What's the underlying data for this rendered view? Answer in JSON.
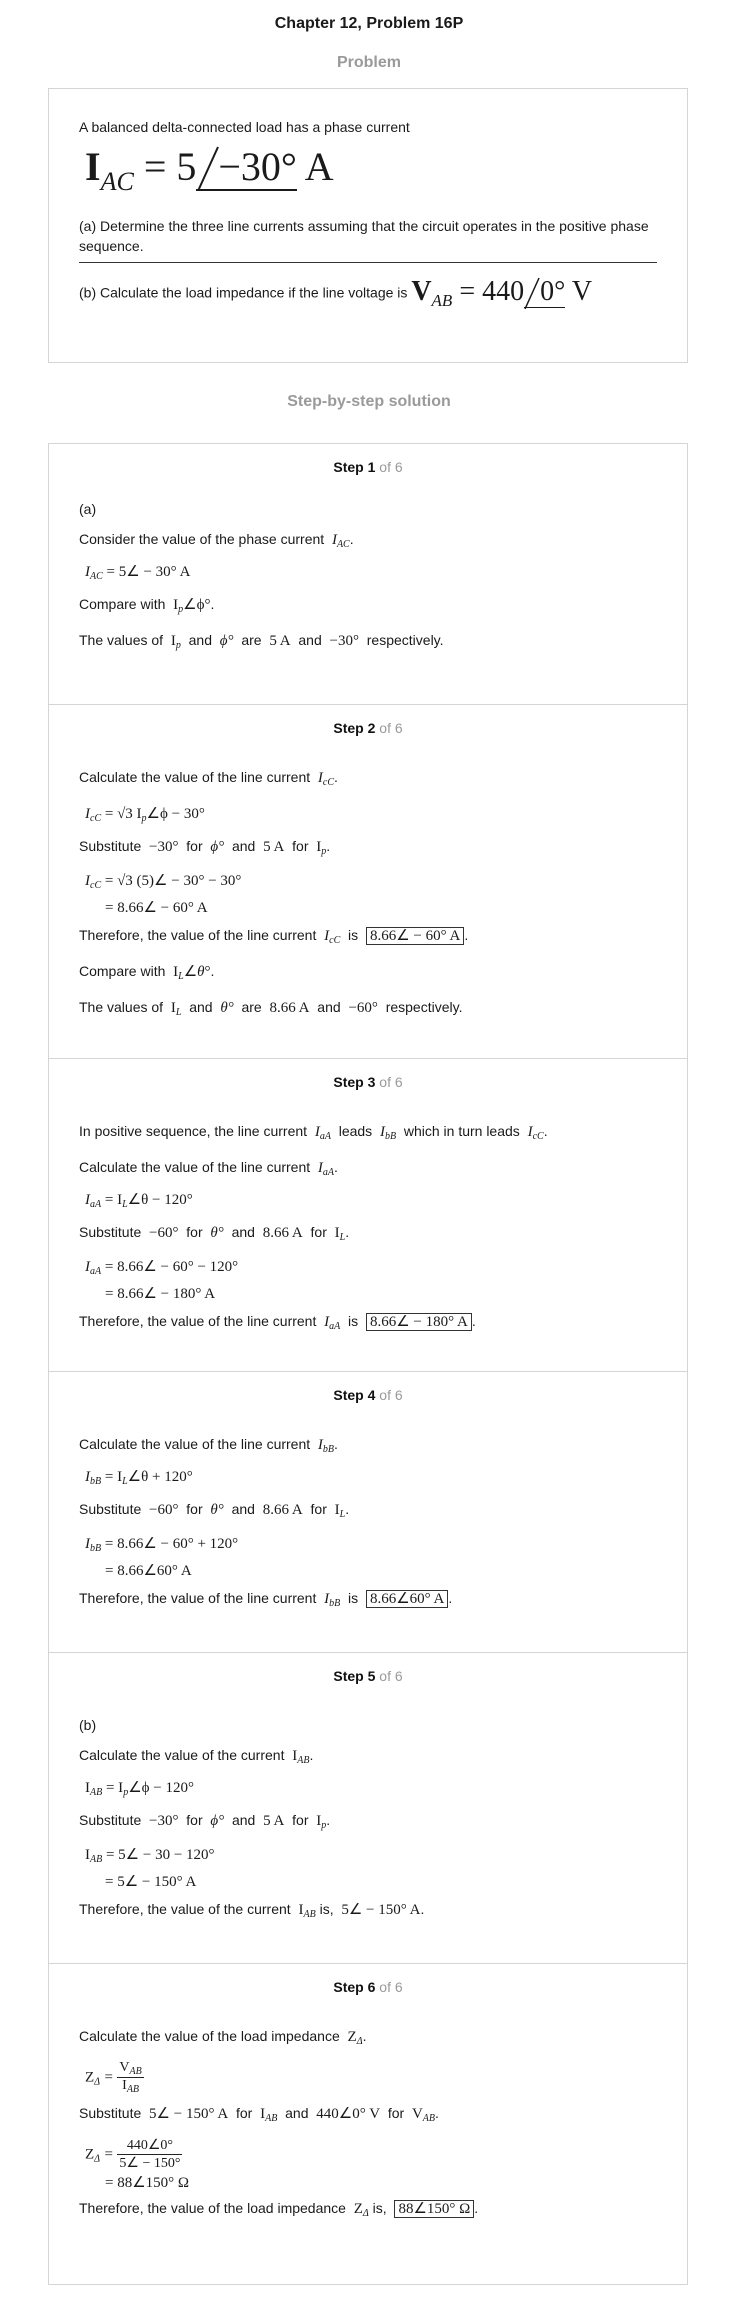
{
  "header": {
    "title": "Chapter 12, Problem 16P"
  },
  "problem": {
    "label": "Problem",
    "intro": "A balanced delta-connected load has a phase current",
    "phasor_symbol": "I",
    "phasor_sub": "AC",
    "phasor_eq": "= 5",
    "phasor_angle": "−30°",
    "phasor_unit": "A",
    "part_a": "(a) Determine the three line currents assuming that the circuit operates in the positive phase sequence.",
    "part_b_text": "(b) Calculate the load impedance if the line voltage is",
    "voltage_symbol": "V",
    "voltage_sub": "AB",
    "voltage_eq": "= 440",
    "voltage_angle": "0°",
    "voltage_unit": "V"
  },
  "solution": {
    "label": "Step-by-step solution"
  },
  "step_word": "Step",
  "step_total": "of 6",
  "steps": [
    {
      "number": "1",
      "lines": {
        "a": "(a)",
        "l1": "Consider the value of the phase current",
        "eq1": "I",
        "eq1_sub": "AC",
        "eq1_rhs": "= 5∠ − 30° A",
        "l2": "Compare with",
        "l2_math": "I",
        "l2_sub": "p",
        "l2_math2": "∠ϕ°",
        "l3_a": "The values of",
        "l3_b": "and",
        "l3_c": "are",
        "l3_d": "and",
        "l3_e": "respectively.",
        "v1": "5 A",
        "v2": "−30°"
      }
    },
    {
      "number": "2",
      "lines": {
        "l1": "Calculate the value of the line current",
        "eq1_rhs": "= √3 I",
        "eq1_tail": "∠ϕ − 30°",
        "l2_a": "Substitute",
        "l2_b": "for",
        "l2_c": "and",
        "l2_d": "for",
        "s1": "−30°",
        "s2": "ϕ°",
        "s3": "5 A",
        "eq2": "= √3 (5)∠ − 30° − 30°",
        "eq3": "= 8.66∠ − 60° A",
        "l3": "Therefore, the value of the line current",
        "l3_is": "is",
        "ans": "8.66∠ − 60° A",
        "l4": "Compare with",
        "l5_a": "The values of",
        "l5_b": "and",
        "l5_c": "are",
        "l5_d": "and",
        "l5_e": "respectively.",
        "v1": "8.66 A",
        "v2": "−60°"
      }
    },
    {
      "number": "3",
      "lines": {
        "l1_a": "In positive sequence, the line current",
        "l1_b": "leads",
        "l1_c": "which in turn leads",
        "l2": "Calculate the value of the line current",
        "eq1": "= I",
        "eq1_tail": "∠θ − 120°",
        "l3_a": "Substitute",
        "l3_b": "for",
        "l3_c": "and",
        "l3_d": "for",
        "s1": "−60°",
        "s2": "θ°",
        "s3": "8.66 A",
        "eq2": "= 8.66∠ − 60° − 120°",
        "eq3": "= 8.66∠ − 180° A",
        "l4": "Therefore, the value of the line current",
        "l4_is": "is",
        "ans": "8.66∠ − 180° A"
      }
    },
    {
      "number": "4",
      "lines": {
        "l1": "Calculate the value of the line current",
        "eq1": "= I",
        "eq1_tail": "∠θ + 120°",
        "l2_a": "Substitute",
        "l2_b": "for",
        "l2_c": "and",
        "l2_d": "for",
        "s1": "−60°",
        "s2": "θ°",
        "s3": "8.66 A",
        "eq2": "= 8.66∠ − 60° + 120°",
        "eq3": "= 8.66∠60° A",
        "l3": "Therefore, the value of the line current",
        "l3_is": "is",
        "ans": "8.66∠60° A"
      }
    },
    {
      "number": "5",
      "lines": {
        "b": "(b)",
        "l1": "Calculate the value of the current",
        "eq1": "= I",
        "eq1_tail": "∠ϕ − 120°",
        "l2_a": "Substitute",
        "l2_b": "for",
        "l2_c": "and",
        "l2_d": "for",
        "s1": "−30°",
        "s2": "ϕ°",
        "s3": "5 A",
        "eq2": "= 5∠ − 30 − 120°",
        "eq3": "= 5∠ − 150° A",
        "l3": "Therefore, the value of the current",
        "l3_is": "is,",
        "ans": "5∠ − 150° A"
      }
    },
    {
      "number": "6",
      "lines": {
        "l1": "Calculate the value of the load impedance",
        "l2_a": "Substitute",
        "l2_b": "for",
        "l2_c": "and",
        "l2_d": "for",
        "s1": "5∠ − 150° A",
        "s2": "440∠0° V",
        "num1": "440∠0°",
        "den1": "5∠ − 150°",
        "eq3": "= 88∠150° Ω",
        "l3": "Therefore, the value of the load impedance",
        "l3_is": "is,",
        "ans": "88∠150° Ω"
      }
    }
  ]
}
